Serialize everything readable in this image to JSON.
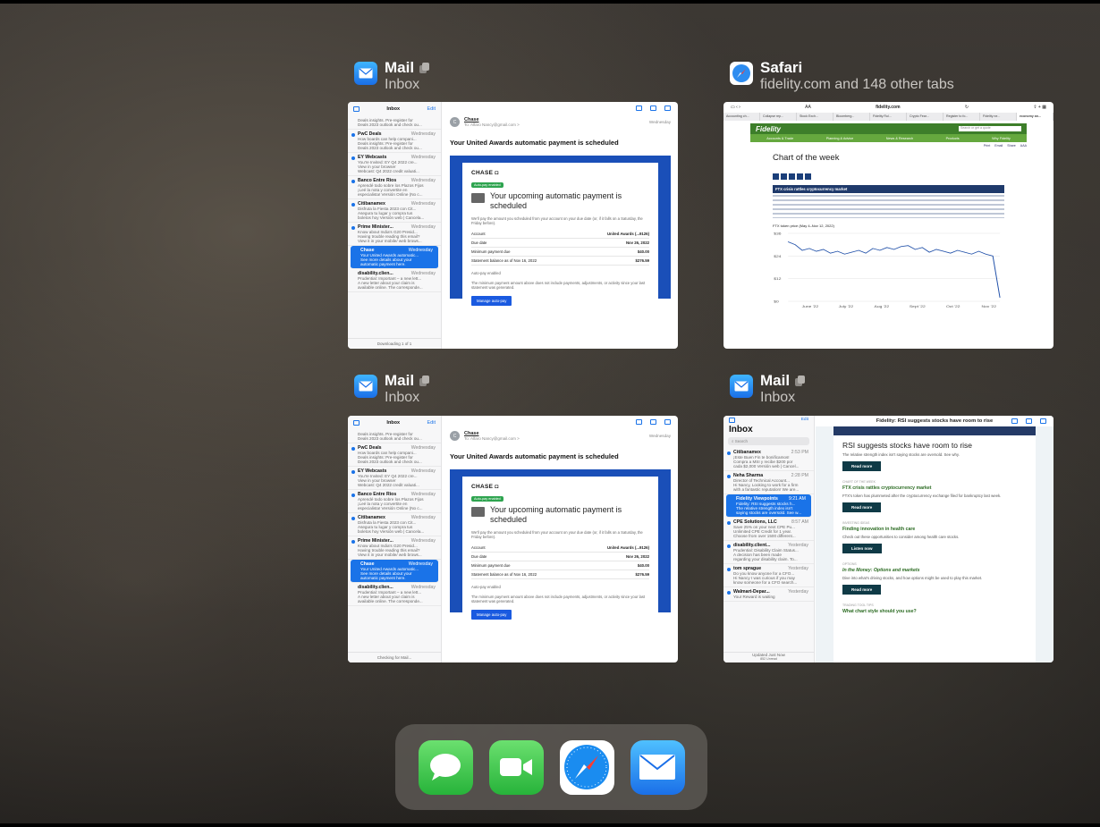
{
  "cards": [
    {
      "app": "Mail",
      "subtitle": "Inbox"
    },
    {
      "app": "Safari",
      "subtitle": "fidelity.com and 148 other tabs"
    },
    {
      "app": "Mail",
      "subtitle": "Inbox"
    },
    {
      "app": "Mail",
      "subtitle": "Inbox"
    }
  ],
  "mail_preview": {
    "list_title": "Inbox",
    "edit": "Edit",
    "items": [
      {
        "sender": "",
        "date": "",
        "lines": [
          "Deals insights. Pre-register for",
          "Deals 2023 outlook and check ou..."
        ]
      },
      {
        "sender": "PwC Deals",
        "date": "Wednesday",
        "lines": [
          "How boards can help compani...",
          "Deals insights: Pre-register for",
          "Deals 2023 outlook and check ou..."
        ]
      },
      {
        "sender": "EY Webcasts",
        "date": "Wednesday",
        "lines": [
          "You're Invited: EY Q4 2022 cre...",
          "View in your browser",
          "Webcast: Q4 2022 credit valuati..."
        ]
      },
      {
        "sender": "Banco Entre Rios",
        "date": "Wednesday",
        "lines": [
          "Aprendé todo sobre los Plazos Fijos",
          "¡Leé la nota y convertite en",
          "especialista! Versión Online (No c..."
        ]
      },
      {
        "sender": "Citibanamex",
        "date": "Wednesday",
        "lines": [
          "Disfruta la Fiesta 2023 con Cit...",
          "Asegura tu lugar y compra tus",
          "boletos hoy Versión web | Cancela..."
        ]
      },
      {
        "sender": "Prime Minister...",
        "date": "Wednesday",
        "lines": [
          "Know about India's G20 Presid...",
          "Having trouble reading this email?",
          "View it in your mobile/ web brows..."
        ]
      },
      {
        "sender": "Chase",
        "date": "Wednesday",
        "lines": [
          "Your United Awards automatic...",
          "See more details about your",
          "automatic payment here."
        ]
      },
      {
        "sender": "disability.clien...",
        "date": "Wednesday",
        "lines": [
          "Prudential: Important – a new lett...",
          "A new letter about your claim is",
          "available online. The corresponde..."
        ]
      }
    ],
    "footer_status_1": "Downloading 1 of 1",
    "footer_status_2": "Checking for Mail...",
    "from_initial": "C",
    "from_name": "Chase",
    "to": "To: Alfaro Nancy@gmail.com >",
    "date": "Wednesday",
    "subject": "Your United Awards automatic payment is scheduled",
    "logo": "CHASE ◘",
    "badge": "Auto-pay enabled",
    "headline": "Your upcoming automatic payment is scheduled",
    "intro": "We'll pay the amount you scheduled from your account on your due date (or, if it falls on a Saturday, the Friday before).",
    "rows": [
      {
        "k": "Account",
        "v": "United Awards (...9126)"
      },
      {
        "k": "Due date",
        "v": "Nov 26, 2022"
      },
      {
        "k": "Minimum payment due",
        "v": "$40.00"
      },
      {
        "k": "Statement balance as of Nov 16, 2022",
        "v": "$276.59"
      }
    ],
    "autopay": "Auto-pay enabled",
    "note": "The minimum payment amount above does not include payments, adjustments, or activity since your last statement was generated.",
    "button": "Manage auto-pay"
  },
  "safari_preview": {
    "aa": "AA",
    "url": "fidelity.com",
    "tabs": [
      "Accounting ch...",
      "Collapse rep...",
      "Stock Exch...",
      "Bloomberg...",
      "Fidelity Rul...",
      "Crypto Fear...",
      "Register to fo...",
      "Fidelity ne...",
      "economy an..."
    ],
    "logo": "Fidelity",
    "search": "Search or get a quote",
    "nav": [
      "Accounts & Trade",
      "Planning & Advice",
      "News & Research",
      "Products",
      "Why Fidelity"
    ],
    "util": [
      "Print",
      "Email",
      "Share",
      "AAA"
    ],
    "heading": "Chart of the week",
    "banner": "FTX crisis rattles cryptocurrency market",
    "chart_title": "FTX token price (May 4–Nov 12, 2022)",
    "chart_data": {
      "type": "line",
      "title": "FTX token price (May 4–Nov 12, 2022)",
      "categories": [
        "June '22",
        "July '22",
        "Aug '22",
        "Sept '22",
        "Oct '22",
        "Nov '22"
      ],
      "y_ticks": [
        "$0",
        "$12",
        "$24",
        "$36"
      ],
      "ylim": [
        0,
        36
      ],
      "x": [
        0,
        2,
        4,
        6,
        8,
        10,
        12,
        14,
        16,
        18,
        20,
        22,
        24,
        26,
        28,
        30,
        32,
        34,
        36,
        38,
        40,
        42,
        44,
        46,
        48,
        50,
        52,
        54,
        56,
        58,
        60
      ],
      "values": [
        31.5,
        30,
        27,
        28,
        26.5,
        27.5,
        25.5,
        26.5,
        25,
        26,
        27,
        25.5,
        28,
        27,
        28.5,
        27.5,
        29,
        29.5,
        27.5,
        28.5,
        26,
        27.5,
        26.5,
        25.5,
        27,
        26,
        25,
        26.5,
        25,
        24,
        2
      ]
    }
  },
  "fidelity_mail_preview": {
    "edit": "Edit",
    "title": "Inbox",
    "search": "Search",
    "view_title": "Fidelity: RSI suggests stocks have room to rise",
    "items": [
      {
        "sender": "Citibanamex",
        "date": "2:53 PM",
        "lines": [
          "¡Este Buen Fin te bonificamos!",
          "Compra a MSI y recibe $200 por",
          "cada $2,000 Versión web | Cancel..."
        ]
      },
      {
        "sender": "Neha Sharma",
        "date": "2:28 PM",
        "lines": [
          "Director of Technical Account...",
          "Hi Nancy, Looking to work for a firm",
          "with a fantastic reputation! We are..."
        ]
      },
      {
        "sender": "Fidelity Viewpoints",
        "date": "9:21 AM",
        "lines": [
          "Fidelity: RSI suggests stocks h...",
          "The relative strength index isn't",
          "saying stocks are oversold. See w..."
        ]
      },
      {
        "sender": "CPE Solutions, LLC",
        "date": "8:57 AM",
        "lines": [
          "Save 25% on your next CPE Pu...",
          "Unlimited CPE Credit for 1 year.",
          "Choose from over 1500 different..."
        ]
      },
      {
        "sender": "disability.client...",
        "date": "Yesterday",
        "lines": [
          "Prudential: Disability Claim Status...",
          "A decision has been made",
          "regarding your disability claim. To..."
        ]
      },
      {
        "sender": "tom sprague",
        "date": "Yesterday",
        "lines": [
          "Do you know anyone for a CFO...",
          "Hi Nancy I was curious if you may",
          "know someone for a CFO search..."
        ]
      },
      {
        "sender": "Walmart-Depar...",
        "date": "Yesterday",
        "lines": [
          "Your Reward is waiting"
        ]
      }
    ],
    "footer": "Updated Just Now",
    "footer2": "852 Unread",
    "headline": "RSI suggests stocks have room to rise",
    "lead": "The relative strength index isn't saying stocks are oversold. See why.",
    "read_more": "Read more",
    "s1_label": "CHART OF THE WEEK",
    "s1_title": "FTX crisis rattles cryptocurrency market",
    "s1_text": "FTX's token has plummeted after the cryptocurrency exchange filed for bankruptcy last week.",
    "s2_label": "INVESTING IDEAS",
    "s2_title": "Finding innovation in health care",
    "s2_text": "Check out these opportunities to consider among health care stocks.",
    "listen_now": "Listen now",
    "s3_label": "OPTIONS",
    "s3_title": "In the Money: Options and markets",
    "s3_text": "Dive into what's driving stocks, and how options might be used to play this market.",
    "s4_label": "TRADING TOOL TIPS",
    "s4_title": "What chart style should you use?"
  },
  "dock": [
    "Messages",
    "FaceTime",
    "Safari",
    "Mail"
  ]
}
